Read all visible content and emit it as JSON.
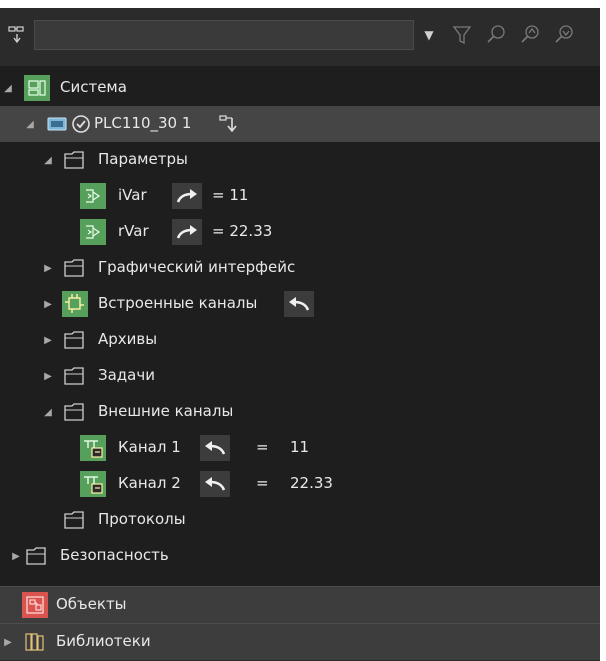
{
  "toolbar": {
    "search_value": "",
    "icons": [
      "hierarchy-icon",
      "chevron-down-icon",
      "filter-icon",
      "search-icon",
      "search-up-icon",
      "search-down-icon"
    ]
  },
  "tree": {
    "system_label": "Система",
    "plc_label": "PLC110_30 1",
    "params_label": "Параметры",
    "ivar_label": "iVar",
    "ivar_value": "= 11",
    "rvar_label": "rVar",
    "rvar_value": "= 22.33",
    "graphic_label": "Графический интерфейс",
    "builtin_label": "Встроенные каналы",
    "archives_label": "Архивы",
    "tasks_label": "Задачи",
    "external_label": "Внешние каналы",
    "ch1_label": "Канал 1",
    "ch1_eq": "=",
    "ch1_value": "11",
    "ch2_label": "Канал 2",
    "ch2_eq": "=",
    "ch2_value": "22.33",
    "protocols_label": "Протоколы",
    "security_label": "Безопасность"
  },
  "sections": {
    "objects_label": "Объекты",
    "libraries_label": "Библиотеки"
  },
  "colors": {
    "panel_bg": "#2b2b2b",
    "tree_bg": "#1e1e1e",
    "selected_row": "#454545",
    "green_icon": "#56a05c",
    "red_icon": "#d9534f",
    "section_bg": "#3d3d3d"
  }
}
